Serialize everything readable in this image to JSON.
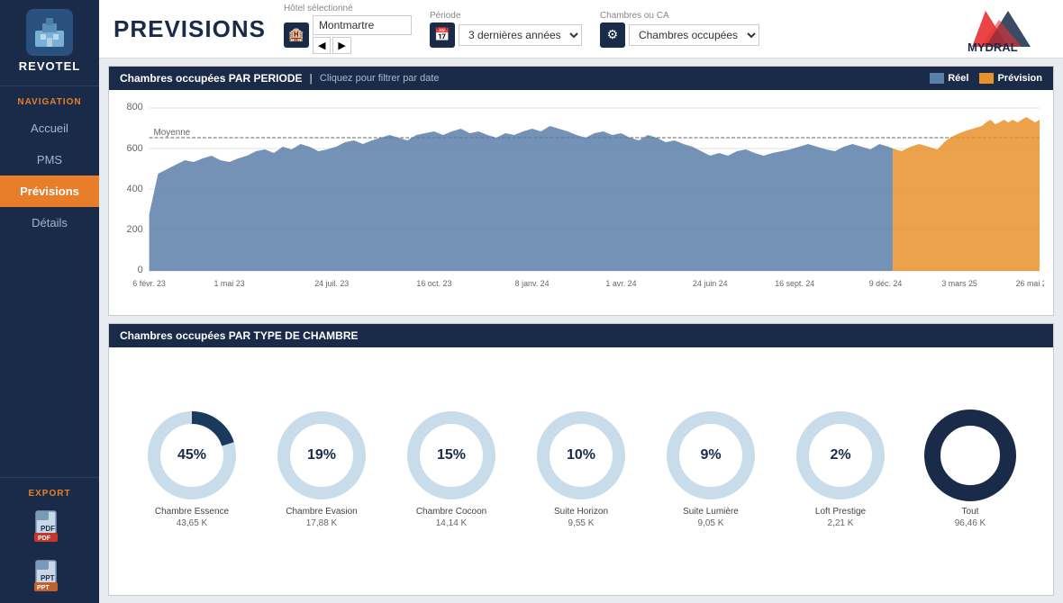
{
  "sidebar": {
    "logo_text": "REVOTEL",
    "nav_label": "NAVIGATION",
    "items": [
      {
        "label": "Accueil",
        "active": false
      },
      {
        "label": "PMS",
        "active": false
      },
      {
        "label": "Prévisions",
        "active": true
      },
      {
        "label": "Détails",
        "active": false
      }
    ],
    "export_label": "EXPORT",
    "export_btns": [
      {
        "label": "PDF"
      },
      {
        "label": "PPT"
      }
    ]
  },
  "header": {
    "title": "PREVISIONS",
    "hotel_label": "Hôtel sélectionné",
    "hotel_value": "Montmartre",
    "periode_label": "Période",
    "periode_value": "3 dernières années",
    "chambre_label": "Chambres ou CA",
    "chambre_value": "Chambres occupées"
  },
  "chart1": {
    "title": "Chambres occupées PAR PERIODE",
    "hint": "Cliquez pour filtrer par date",
    "legend_reel": "Réel",
    "legend_prevision": "Prévision",
    "y_labels": [
      "800",
      "600",
      "400",
      "200",
      "0"
    ],
    "x_labels": [
      "6 févr. 23",
      "1 mai 23",
      "24 juil. 23",
      "16 oct. 23",
      "8 janv. 24",
      "1 avr. 24",
      "24 juin 24",
      "16 sept. 24",
      "9 déc. 24",
      "3 mars 25",
      "26 mai 25"
    ],
    "moyenne_label": "Moyenne"
  },
  "chart2": {
    "title": "Chambres occupées PAR TYPE DE CHAMBRE",
    "donuts": [
      {
        "pct": "45%",
        "name": "Chambre Essence",
        "value": "43,65 K",
        "filled": 45,
        "dark": true
      },
      {
        "pct": "19%",
        "name": "Chambre Evasion",
        "value": "17,88 K",
        "filled": 19,
        "dark": false
      },
      {
        "pct": "15%",
        "name": "Chambre Cocoon",
        "value": "14,14 K",
        "filled": 15,
        "dark": false
      },
      {
        "pct": "10%",
        "name": "Suite Horizon",
        "value": "9,55 K",
        "filled": 10,
        "dark": true
      },
      {
        "pct": "9%",
        "name": "Suite Lumière",
        "value": "9,05 K",
        "filled": 9,
        "dark": false
      },
      {
        "pct": "2%",
        "name": "Loft Prestige",
        "value": "2,21 K",
        "filled": 2,
        "dark": false
      },
      {
        "pct": "100%",
        "name": "Tout",
        "value": "96,46 K",
        "filled": 100,
        "dark": true,
        "all": true
      }
    ]
  },
  "brand": {
    "name": "MYDRAL"
  }
}
